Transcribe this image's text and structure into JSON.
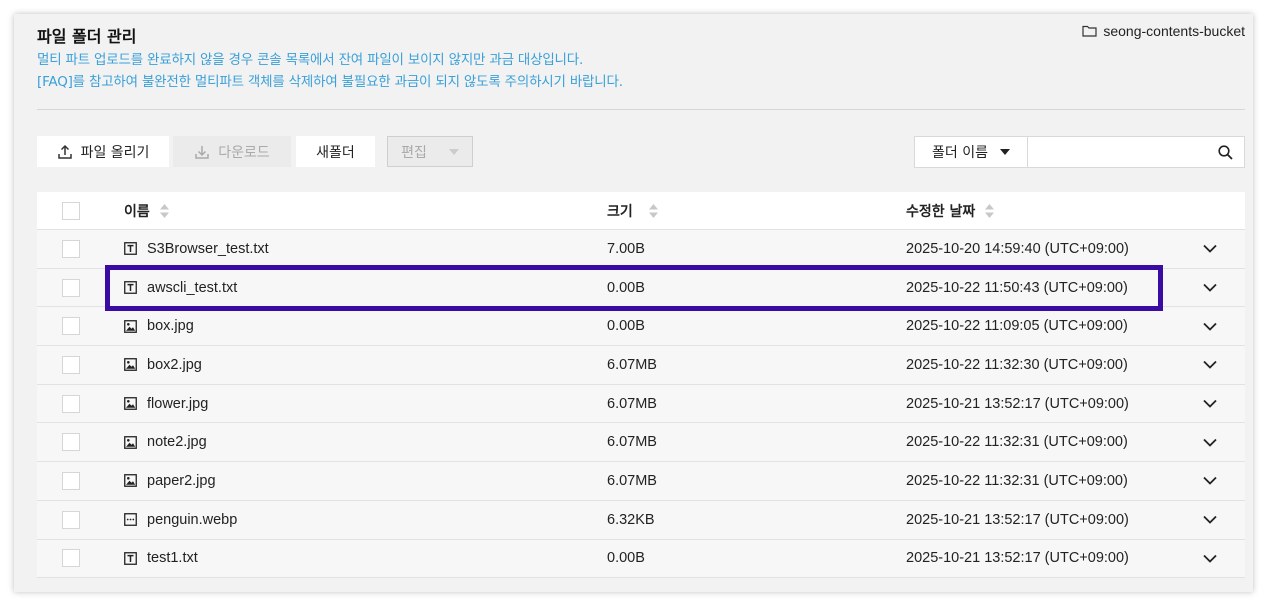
{
  "header": {
    "title": "파일 폴더 관리",
    "bucket_name": "seong-contents-bucket",
    "notice_line1": "멀티 파트 업로드를 완료하지 않을 경우 콘솔 목록에서 잔여 파일이 보이지 않지만 과금 대상입니다.",
    "notice_line2": "[FAQ]를 참고하여 불완전한 멀티파트 객체를 삭제하여 불필요한 과금이 되지 않도록 주의하시기 바랍니다."
  },
  "toolbar": {
    "upload_label": "파일 올리기",
    "download_label": "다운로드",
    "newfolder_label": "새폴더",
    "edit_label": "편집"
  },
  "search": {
    "select_label": "폴더 이름",
    "input_value": ""
  },
  "table": {
    "columns": {
      "name": "이름",
      "size": "크기",
      "modified": "수정한 날짜"
    },
    "rows": [
      {
        "name": "S3Browser_test.txt",
        "size": "7.00B",
        "modified": "2025-10-20 14:59:40 (UTC+09:00)",
        "icon": "text-file-icon"
      },
      {
        "name": "awscli_test.txt",
        "size": "0.00B",
        "modified": "2025-10-22 11:50:43 (UTC+09:00)",
        "icon": "text-file-icon"
      },
      {
        "name": "box.jpg",
        "size": "0.00B",
        "modified": "2025-10-22 11:09:05 (UTC+09:00)",
        "icon": "image-file-icon"
      },
      {
        "name": "box2.jpg",
        "size": "6.07MB",
        "modified": "2025-10-22 11:32:30 (UTC+09:00)",
        "icon": "image-file-icon"
      },
      {
        "name": "flower.jpg",
        "size": "6.07MB",
        "modified": "2025-10-21 13:52:17 (UTC+09:00)",
        "icon": "image-file-icon"
      },
      {
        "name": "note2.jpg",
        "size": "6.07MB",
        "modified": "2025-10-22 11:32:31 (UTC+09:00)",
        "icon": "image-file-icon"
      },
      {
        "name": "paper2.jpg",
        "size": "6.07MB",
        "modified": "2025-10-22 11:32:31 (UTC+09:00)",
        "icon": "image-file-icon"
      },
      {
        "name": "penguin.webp",
        "size": "6.32KB",
        "modified": "2025-10-21 13:52:17 (UTC+09:00)",
        "icon": "generic-file-icon"
      },
      {
        "name": "test1.txt",
        "size": "0.00B",
        "modified": "2025-10-21 13:52:17 (UTC+09:00)",
        "icon": "text-file-icon"
      }
    ]
  },
  "colors": {
    "notice_text": "#3aa0d8",
    "highlight_border": "#3a0ca3",
    "panel_background": "#f2f2f2"
  }
}
